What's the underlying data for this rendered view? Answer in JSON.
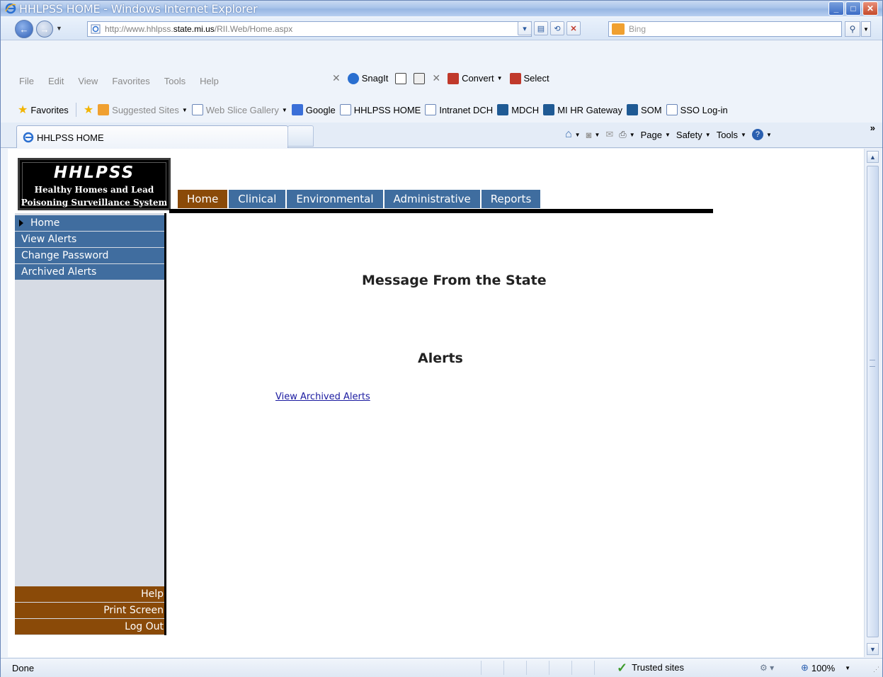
{
  "window": {
    "title": "HHLPSS HOME - Windows Internet Explorer"
  },
  "address": {
    "url_prefix": "http://www.hhlpss.",
    "url_domain": "state.mi.us",
    "url_suffix": "/RII.Web/Home.aspx"
  },
  "search": {
    "placeholder": "Bing"
  },
  "menu": {
    "file": "File",
    "edit": "Edit",
    "view": "View",
    "favorites": "Favorites",
    "tools": "Tools",
    "help": "Help"
  },
  "snagit": {
    "snagit_label": "SnagIt",
    "convert_label": "Convert",
    "select_label": "Select"
  },
  "favbar": {
    "favorites": "Favorites",
    "items": [
      {
        "label": "Suggested Sites"
      },
      {
        "label": "Web Slice Gallery"
      },
      {
        "label": "Google"
      },
      {
        "label": "HHLPSS HOME"
      },
      {
        "label": "Intranet DCH"
      },
      {
        "label": "MDCH"
      },
      {
        "label": "MI HR Gateway"
      },
      {
        "label": "SOM"
      },
      {
        "label": "SSO Log-in"
      }
    ]
  },
  "tab": {
    "title": "HHLPSS HOME"
  },
  "commandbar": {
    "page": "Page",
    "safety": "Safety",
    "tools": "Tools"
  },
  "app": {
    "logo_title": "HHLPSS",
    "logo_line1": "Healthy Homes and Lead",
    "logo_line2": "Poisoning Surveillance System",
    "nav_tabs": [
      {
        "label": "Home"
      },
      {
        "label": "Clinical"
      },
      {
        "label": "Environmental"
      },
      {
        "label": "Administrative"
      },
      {
        "label": "Reports"
      }
    ],
    "sidebar": {
      "items": [
        {
          "label": "Home"
        },
        {
          "label": "View Alerts"
        },
        {
          "label": "Change Password"
        },
        {
          "label": "Archived Alerts"
        }
      ],
      "bottom_items": [
        {
          "label": "Help"
        },
        {
          "label": "Print Screen"
        },
        {
          "label": "Log Out"
        }
      ]
    },
    "message_heading": "Message From the State",
    "alerts_heading": "Alerts",
    "archived_link": "View Archived Alerts"
  },
  "status": {
    "text": "Done",
    "zone": "Trusted sites",
    "zoom": "100%"
  },
  "colors": {
    "nav_blue": "#3f6d9f",
    "nav_active_brown": "#8a4a08",
    "sidebar_bg": "#d6dbe4"
  }
}
